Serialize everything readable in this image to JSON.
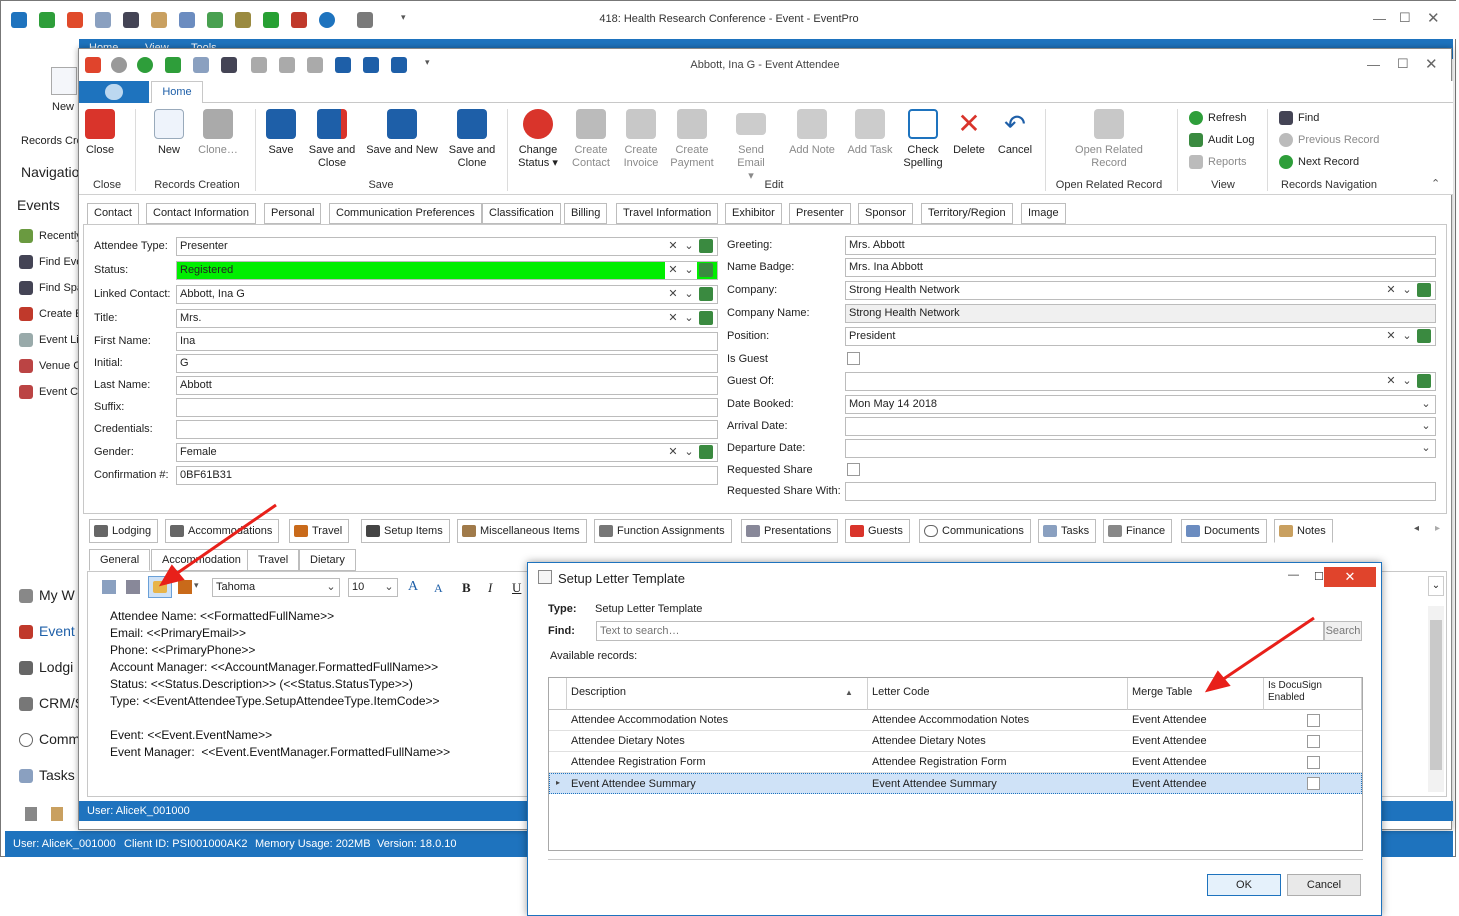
{
  "main_window": {
    "title": "418: Health Research Conference - Event - EventPro",
    "tabs": [
      "Home",
      "View",
      "Tools"
    ],
    "left_panel": {
      "new_label": "New",
      "records_creation_label": "Records Cre",
      "navigation_header": "Navigation",
      "events_header": "Events",
      "items": [
        "Recently",
        "Find Eve",
        "Find Spa",
        "Create E",
        "Event Lis",
        "Venue C",
        "Event Ca"
      ],
      "bottom_items": [
        "My W",
        "Event",
        "Lodgi",
        "CRM/S",
        "Comm",
        "Tasks"
      ]
    },
    "status": {
      "user": "User: AliceK_001000",
      "client": "Client ID: PSI001000AK2",
      "memory": "Memory Usage: 202MB",
      "version": "Version: 18.0.10"
    }
  },
  "attendee_window": {
    "title": "Abbott, Ina G - Event Attendee",
    "ribbon_tab": "Home",
    "ribbon": {
      "close": "Close",
      "new": "New",
      "clone": "Clone…",
      "save": "Save",
      "save_close_1": "Save and",
      "save_close_2": "Close",
      "save_new": "Save and New",
      "save_clone_1": "Save and",
      "save_clone_2": "Clone",
      "change_status_1": "Change",
      "change_status_2": "Status",
      "create_contact_1": "Create",
      "create_contact_2": "Contact",
      "create_invoice_1": "Create",
      "create_invoice_2": "Invoice",
      "create_payment_1": "Create",
      "create_payment_2": "Payment",
      "send_email": "Send Email",
      "add_note": "Add Note",
      "add_task": "Add Task",
      "check_spelling_1": "Check",
      "check_spelling_2": "Spelling",
      "delete": "Delete",
      "cancel": "Cancel",
      "open_related_1": "Open Related",
      "open_related_2": "Record",
      "refresh": "Refresh",
      "audit_log": "Audit Log",
      "reports": "Reports",
      "find": "Find",
      "previous_record": "Previous Record",
      "next_record": "Next Record",
      "groups": {
        "close": "Close",
        "records_creation": "Records Creation",
        "save": "Save",
        "edit": "Edit",
        "open_related": "Open Related Record",
        "view": "View",
        "records_navigation": "Records Navigation"
      }
    },
    "form_tabs": [
      "Contact",
      "Contact Information",
      "Personal",
      "Communication Preferences",
      "Classification",
      "Billing",
      "Travel Information",
      "Exhibitor",
      "Presenter",
      "Sponsor",
      "Territory/Region",
      "Image"
    ],
    "fields_left": {
      "attendee_type_label": "Attendee Type:",
      "attendee_type": "Presenter",
      "status_label": "Status:",
      "status": "Registered",
      "linked_contact_label": "Linked Contact:",
      "linked_contact": "Abbott, Ina G",
      "title_label": "Title:",
      "title": "Mrs.",
      "first_name_label": "First Name:",
      "first_name": "Ina",
      "initial_label": "Initial:",
      "initial": "G",
      "last_name_label": "Last Name:",
      "last_name": "Abbott",
      "suffix_label": "Suffix:",
      "suffix": "",
      "credentials_label": "Credentials:",
      "credentials": "",
      "gender_label": "Gender:",
      "gender": "Female",
      "confirmation_label": "Confirmation #:",
      "confirmation": "0BF61B31"
    },
    "fields_right": {
      "greeting_label": "Greeting:",
      "greeting": "Mrs. Abbott",
      "name_badge_label": "Name Badge:",
      "name_badge": "Mrs. Ina Abbott",
      "company_label": "Company:",
      "company": "Strong Health Network",
      "company_name_label": "Company Name:",
      "company_name": "Strong Health Network",
      "position_label": "Position:",
      "position": "President",
      "is_guest_label": "Is Guest",
      "guest_of_label": "Guest Of:",
      "guest_of": "",
      "date_booked_label": "Date Booked:",
      "date_booked": "Mon May 14 2018",
      "arrival_label": "Arrival Date:",
      "arrival": "",
      "departure_label": "Departure Date:",
      "departure": "",
      "requested_share_label": "Requested Share",
      "requested_share_with_label": "Requested Share With:",
      "requested_share_with": ""
    },
    "bottom_tabs": [
      "Lodging",
      "Accommodations",
      "Travel",
      "Setup Items",
      "Miscellaneous Items",
      "Function Assignments",
      "Presentations",
      "Guests",
      "Communications",
      "Tasks",
      "Finance",
      "Documents",
      "Notes"
    ],
    "notes_subtabs": [
      "General",
      "Accommodation",
      "Travel",
      "Dietary"
    ],
    "notes_toolbar": {
      "font": "Tahoma",
      "size": "10"
    },
    "notes_lines": [
      "Attendee Name: <<FormattedFullName>>",
      "Email: <<PrimaryEmail>>",
      "Phone: <<PrimaryPhone>>",
      "Account Manager: <<AccountManager.FormattedFullName>>",
      "Status: <<Status.Description>> (<<Status.StatusType>>)",
      "Type: <<EventAttendeeType.SetupAttendeeType.ItemCode>>",
      "",
      "Event: <<Event.EventName>>",
      "Event Manager:  <<Event.EventManager.FormattedFullName>>"
    ],
    "status_user": "User: AliceK_001000"
  },
  "dialog": {
    "title": "Setup Letter Template",
    "type_label": "Type:",
    "type_value": "Setup Letter Template",
    "find_label": "Find:",
    "find_placeholder": "Text to search…",
    "search_button": "Search",
    "available_label": "Available records:",
    "columns": {
      "description": "Description",
      "letter_code": "Letter Code",
      "merge_table": "Merge Table",
      "docusign_1": "Is DocuSign",
      "docusign_2": "Enabled"
    },
    "rows": [
      {
        "description": "Attendee Accommodation Notes",
        "letter_code": "Attendee Accommodation Notes",
        "merge_table": "Event Attendee"
      },
      {
        "description": "Attendee Dietary Notes",
        "letter_code": "Attendee Dietary Notes",
        "merge_table": "Event Attendee"
      },
      {
        "description": "Attendee Registration Form",
        "letter_code": "Attendee Registration Form",
        "merge_table": "Event Attendee"
      },
      {
        "description": "Event Attendee Summary",
        "letter_code": "Event Attendee Summary",
        "merge_table": "Event Attendee"
      }
    ],
    "ok": "OK",
    "cancel": "Cancel"
  },
  "colors": {
    "accent": "#1e73be",
    "status_green": "#00ee00",
    "annotation_arrow": "#e8201a",
    "close_red": "#e0442c"
  }
}
